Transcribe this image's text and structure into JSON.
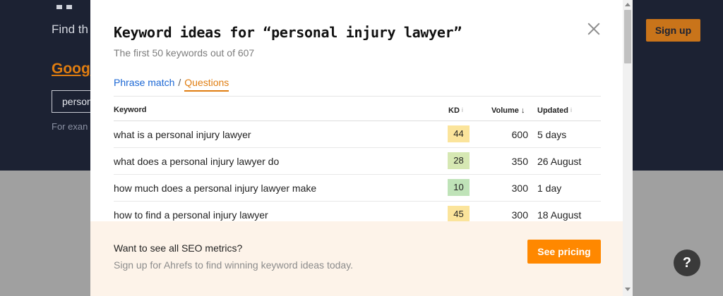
{
  "background": {
    "find_text": "Find th",
    "google_text": "Goog",
    "input_text": "person",
    "example_text": "For exan",
    "signup_label": "Sign up"
  },
  "modal": {
    "title": "Keyword ideas for “personal injury lawyer”",
    "subtitle": "The first 50 keywords out of 607",
    "tabs": [
      {
        "label": "Phrase match",
        "active": false
      },
      {
        "label": "Questions",
        "active": true
      }
    ],
    "tab_separator": "/",
    "columns": {
      "keyword": "Keyword",
      "kd": "KD",
      "volume": "Volume ↓",
      "updated": "Updated",
      "info_icon": "i"
    },
    "rows": [
      {
        "keyword": "what is a personal injury lawyer",
        "kd": "44",
        "kd_color": "#fbe49b",
        "volume": "600",
        "updated": "5 days"
      },
      {
        "keyword": "what does a personal injury lawyer do",
        "kd": "28",
        "kd_color": "#d6e8b3",
        "volume": "350",
        "updated": "26 August"
      },
      {
        "keyword": "how much does a personal injury lawyer make",
        "kd": "10",
        "kd_color": "#bfe3b8",
        "volume": "300",
        "updated": "1 day"
      },
      {
        "keyword": "how to find a personal injury lawyer",
        "kd": "45",
        "kd_color": "#fbe49b",
        "volume": "300",
        "updated": "18 August"
      }
    ],
    "footer": {
      "title": "Want to see all SEO metrics?",
      "subtitle": "Sign up for Ahrefs to find winning keyword ideas today.",
      "button_label": "See pricing"
    }
  },
  "help_label": "?",
  "colors": {
    "accent": "#ff8800",
    "link": "#1a66d4",
    "tab_active": "#e07d10",
    "header_bg": "#1c2233"
  }
}
